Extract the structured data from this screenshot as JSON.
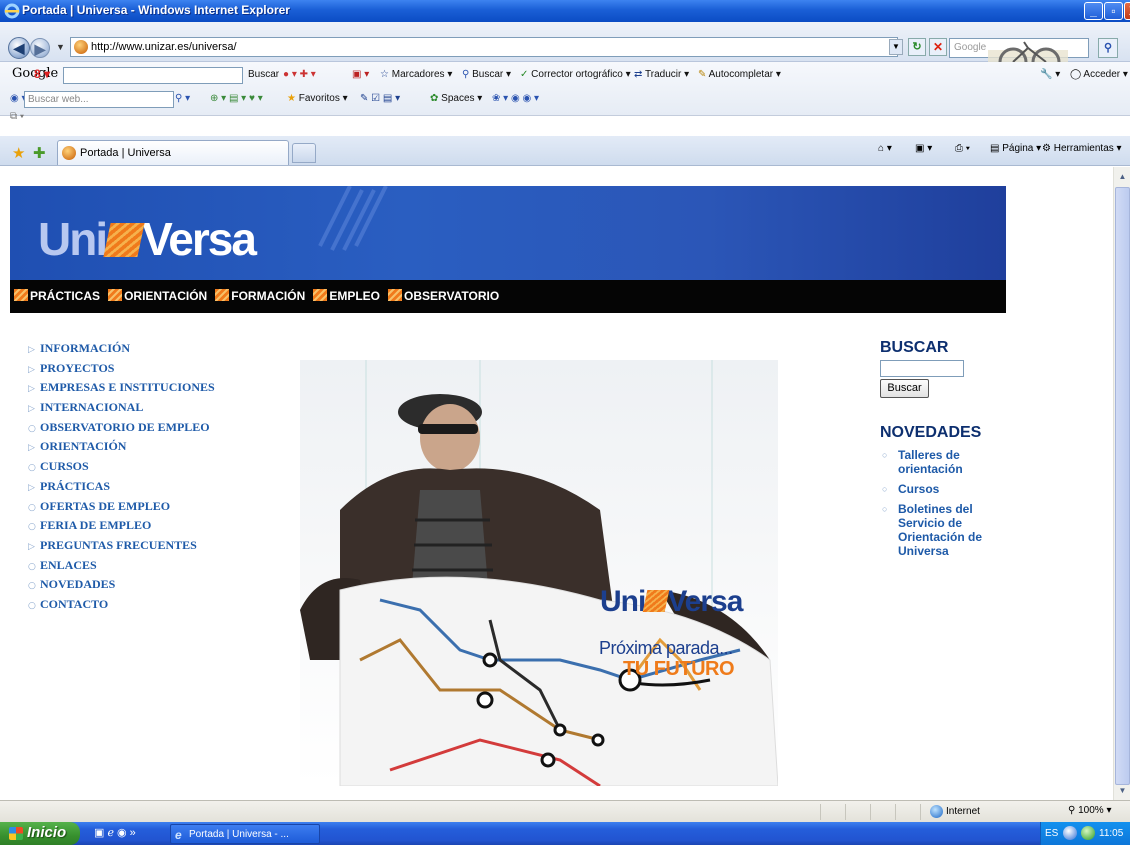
{
  "window": {
    "title": "Portada | Universa - Windows Internet Explorer",
    "controls": [
      "_",
      "▫",
      "X"
    ]
  },
  "addressbar": {
    "url": "http://www.unizar.es/universa/",
    "search_placeholder": "Google"
  },
  "google_toolbar": {
    "logo": "Google",
    "g_button": "8 ▾",
    "buscar": "Buscar",
    "marcadores": "Marcadores",
    "buscar2": "Buscar",
    "corrector": "Corrector ortográfico",
    "traducir": "Traducir",
    "autocompletar": "Autocompletar",
    "acceder": "Acceder",
    "search_placeholder": "Buscar web...",
    "favoritos": "Favoritos",
    "spaces": "Spaces"
  },
  "tabs": {
    "active_label": "Portada | Universa"
  },
  "commandbar": {
    "pagina": "Página",
    "herramientas": "Herramientas"
  },
  "site": {
    "logo": {
      "uni": "Uni",
      "versa": "Versa"
    },
    "topnav": [
      "PRÁCTICAS",
      "ORIENTACIÓN",
      "FORMACIÓN",
      "EMPLEO",
      "OBSERVATORIO"
    ],
    "left_menu": [
      {
        "label": "INFORMACIÓN",
        "bullet": "▷"
      },
      {
        "label": "PROYECTOS",
        "bullet": "▷"
      },
      {
        "label": "EMPRESAS E INSTITUCIONES",
        "bullet": "▷"
      },
      {
        "label": "INTERNACIONAL",
        "bullet": "▷"
      },
      {
        "label": "OBSERVATORIO DE EMPLEO",
        "bullet": "○"
      },
      {
        "label": "ORIENTACIÓN",
        "bullet": "▷"
      },
      {
        "label": "CURSOS",
        "bullet": "○"
      },
      {
        "label": "PRÁCTICAS",
        "bullet": "▷"
      },
      {
        "label": "OFERTAS DE EMPLEO",
        "bullet": "○"
      },
      {
        "label": "FERIA DE EMPLEO",
        "bullet": "○"
      },
      {
        "label": "PREGUNTAS FRECUENTES",
        "bullet": "▷"
      },
      {
        "label": "ENLACES",
        "bullet": "○"
      },
      {
        "label": "NOVEDADES",
        "bullet": "○"
      },
      {
        "label": "CONTACTO",
        "bullet": "○"
      }
    ],
    "hero": {
      "brand": {
        "uni": "Uni",
        "versa": "Versa"
      },
      "tagline1": "Próxima parada...",
      "tagline2": "TU FUTURO"
    },
    "buscar": {
      "title": "BUSCAR",
      "input_value": "",
      "button": "Buscar"
    },
    "novedades": {
      "title": "NOVEDADES",
      "items": [
        "Talleres de orientación",
        "Cursos",
        "Boletines del Servicio de Orientación de Universa"
      ]
    }
  },
  "statusbar": {
    "zone": "Internet",
    "zoom": "100%"
  },
  "taskbar": {
    "start": "Inicio",
    "task_label": "Portada | Universa - ...",
    "lang": "ES",
    "clock": "11:05"
  },
  "colors": {
    "banner": "#2a5ec1",
    "nav_black": "#050505",
    "accent_orange": "#f07a1b",
    "link_blue": "#1e5aa8",
    "heading_navy": "#0d2f6f"
  }
}
